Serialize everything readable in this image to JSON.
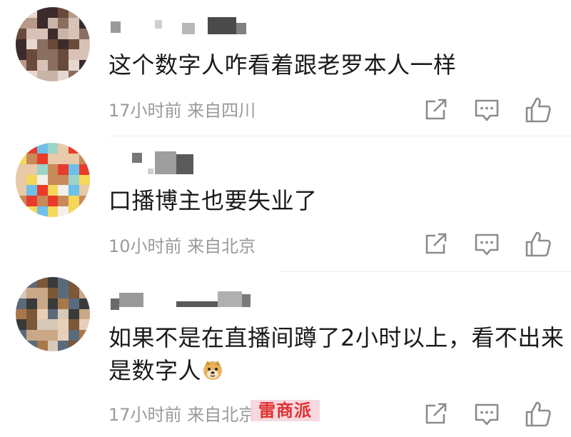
{
  "comments": [
    {
      "text": "这个数字人咋看着跟老罗本人一样",
      "time": "17小时前",
      "location": "来自四川",
      "avatar_colors": [
        "#d8c2b8",
        "#b89a8a",
        "#6a4a3a",
        "#3b2b2b",
        "#8a6f60",
        "#c9b4a8",
        "#e6d8d0"
      ]
    },
    {
      "text": "口播博主也要失业了",
      "time": "10小时前",
      "location": "来自北京",
      "avatar_colors": [
        "#f4efe8",
        "#e8c9a8",
        "#c98a5a",
        "#9bd3c9",
        "#6fc0e8",
        "#f5d75a",
        "#e83b2b"
      ]
    },
    {
      "text_line1": "如果不是在直播间蹲了2小时以上，看不出来",
      "text_line2": "是数字人",
      "emoji": "doge-emoji",
      "time": "17小时前",
      "location": "来自北京",
      "avatar_colors": [
        "#c9a888",
        "#a8784a",
        "#7a5838",
        "#e8d0b8",
        "#5a6a7a",
        "#3a3a3a",
        "#d8c8b8"
      ]
    }
  ],
  "watermark": "雷商派",
  "icons": {
    "share": "share-icon",
    "comment": "comment-icon",
    "like": "thumbs-up-icon"
  },
  "colors": {
    "text": "#1a1a1a",
    "meta": "#9a9a9a",
    "icon": "#8c8c8c",
    "watermark": "#e02020"
  }
}
